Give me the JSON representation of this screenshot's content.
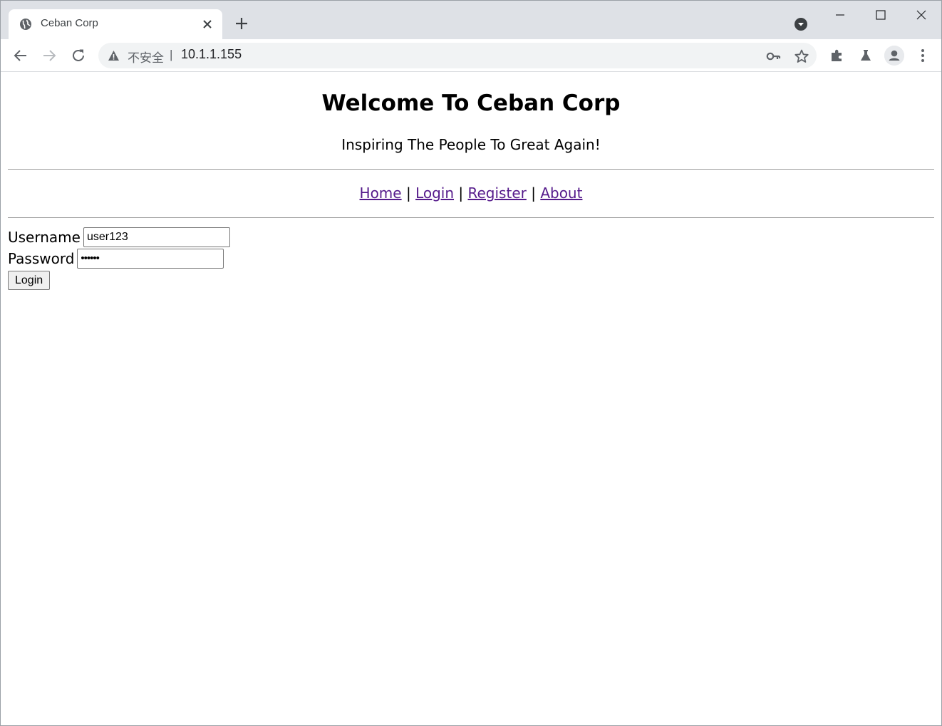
{
  "browser": {
    "tab": {
      "title": "Ceban Corp"
    },
    "omnibox": {
      "security_label": "不安全",
      "separator": "|",
      "url": "10.1.1.155"
    }
  },
  "page": {
    "title": "Welcome To Ceban Corp",
    "subtitle": "Inspiring The People To Great Again!",
    "nav": {
      "items": [
        {
          "label": "Home"
        },
        {
          "label": "Login"
        },
        {
          "label": "Register"
        },
        {
          "label": "About"
        }
      ],
      "separator": "|"
    },
    "form": {
      "username_label": "Username",
      "username_value": "user123",
      "password_label": "Password",
      "password_value": "••••••",
      "submit_label": "Login"
    }
  },
  "colors": {
    "link_visited": "#551a8b",
    "tabstrip_bg": "#dee1e6",
    "omnibox_bg": "#f1f3f4",
    "icon_gray": "#5f6368"
  }
}
